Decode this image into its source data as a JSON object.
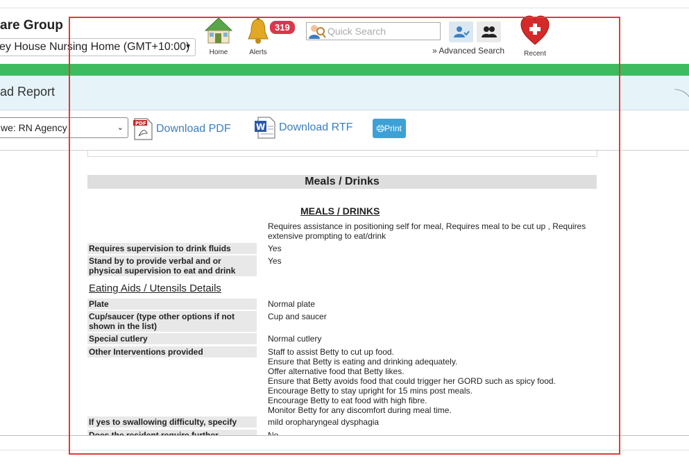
{
  "header": {
    "group_title": "are Group",
    "facility": "ey House Nursing Home (GMT+10:00)",
    "nav": {
      "home_label": "Home",
      "alerts_label": "Alerts",
      "alerts_count": "319",
      "recent_label": "Recent"
    },
    "search": {
      "placeholder": "Quick Search",
      "advanced_label": "» Advanced Search"
    }
  },
  "report": {
    "title": "ad Report",
    "template_selected": "we: RN Agency",
    "download_pdf": "Download PDF",
    "download_rtf": "Download RTF",
    "print_label": "Print"
  },
  "meals": {
    "section_title": "Meals / Drinks",
    "sub_title": "MEALS / DRINKS",
    "summary": "Requires assistance in positioning self for meal, Requires meal to be cut up , Requires extensive prompting to eat/drink",
    "fields": [
      {
        "label": "Requires supervision to drink fluids",
        "value": "Yes"
      },
      {
        "label": "Stand by to provide verbal and or physical supervision to eat and drink",
        "value": "Yes"
      }
    ],
    "aids_heading": "Eating Aids / Utensils Details",
    "aids": [
      {
        "label": "Plate",
        "value": "Normal plate"
      },
      {
        "label": "Cup/saucer (type other options if not shown in the list)",
        "value": "Cup and saucer"
      },
      {
        "label": "Special cutlery",
        "value": "Normal cutlery"
      }
    ],
    "interventions_label": "Other Interventions provided",
    "interventions": [
      "Staff to assist Betty to cut up food.",
      "Ensure that Betty is eating and drinking adequately.",
      "Offer alternative food that Betty likes.",
      "Ensure that Betty avoids  food that could trigger her GORD such as spicy food.",
      "Encourage Betty to stay upright for 15 mins post meals.",
      "Encourage Betty to eat food with high fibre.",
      "Monitor Betty  for any discomfort during meal time."
    ],
    "swallow_label": "If yes to swallowing difficulty, specify",
    "swallow_value": "mild oropharyngeal dysphagia",
    "further_label": "Does the resident require further",
    "further_value": "No"
  },
  "colors": {
    "green_bar": "#3dbb5e",
    "band": "#e6f3f9",
    "link": "#3a7ebf",
    "print": "#3da1d6",
    "badge": "#d9384a",
    "frame": "#e03b3b"
  }
}
